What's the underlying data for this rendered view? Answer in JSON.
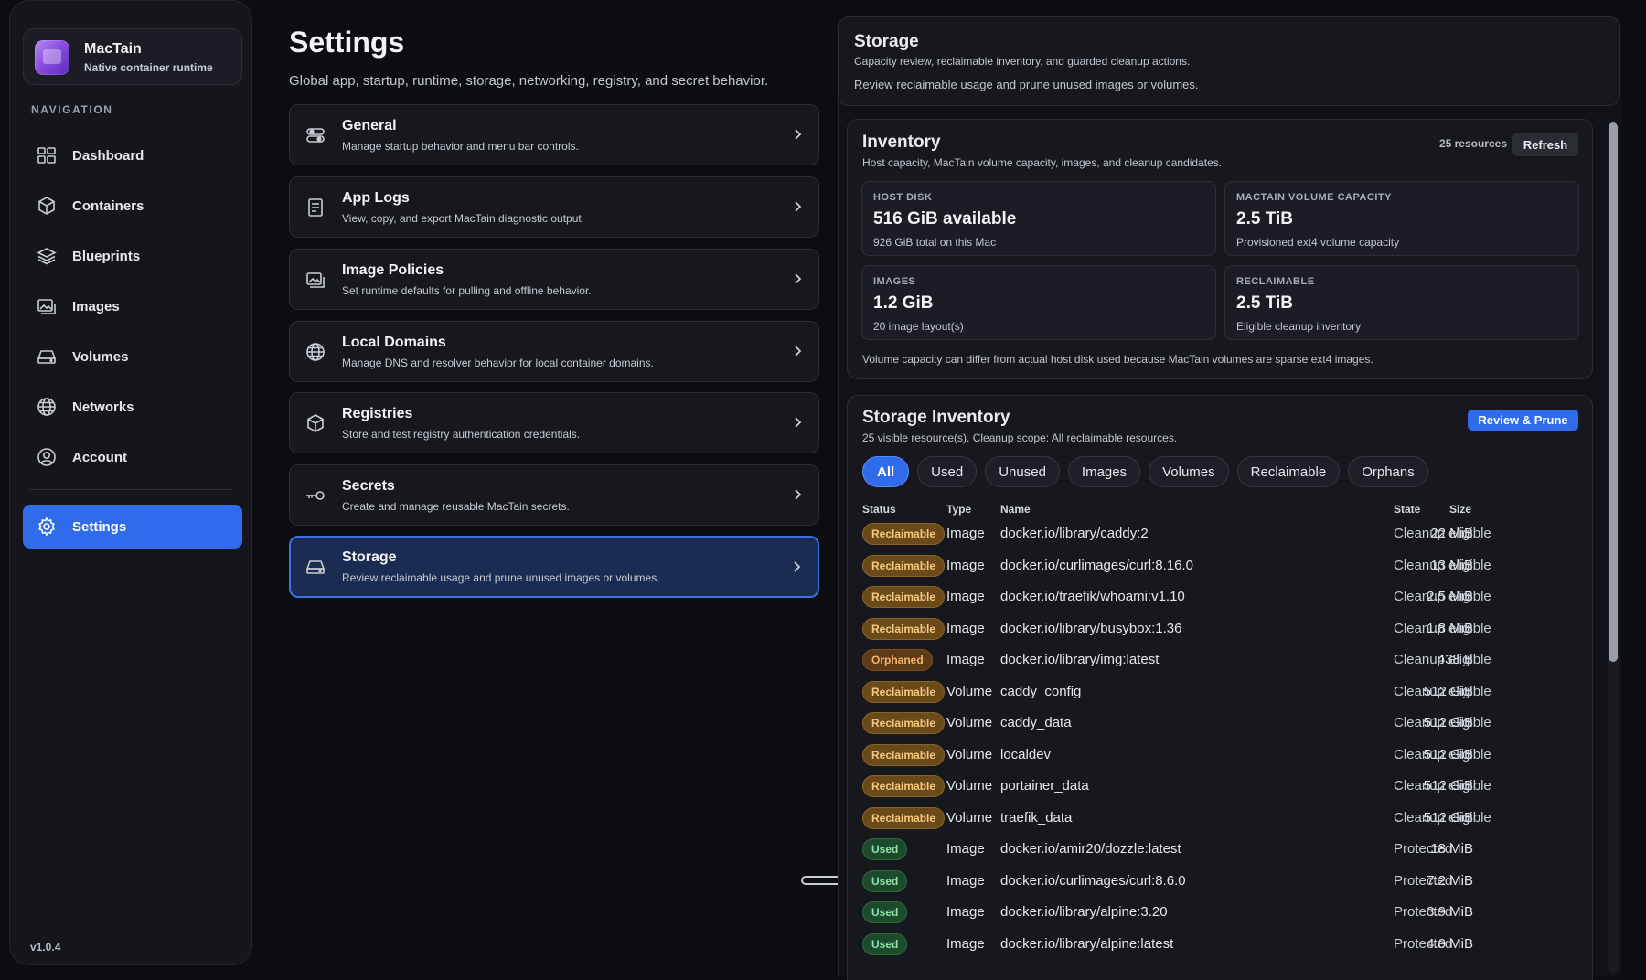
{
  "app": {
    "name": "MacTain",
    "subtitle": "Native container runtime",
    "version": "v1.0.4"
  },
  "sidebar": {
    "heading": "NAVIGATION",
    "items": [
      {
        "label": "Dashboard",
        "icon": "dashboard-icon"
      },
      {
        "label": "Containers",
        "icon": "containers-icon"
      },
      {
        "label": "Blueprints",
        "icon": "blueprints-icon"
      },
      {
        "label": "Images",
        "icon": "images-icon"
      },
      {
        "label": "Volumes",
        "icon": "volumes-icon"
      },
      {
        "label": "Networks",
        "icon": "networks-icon"
      },
      {
        "label": "Account",
        "icon": "account-icon"
      },
      {
        "label": "Settings",
        "icon": "gear-icon",
        "active": true
      }
    ]
  },
  "settings": {
    "title": "Settings",
    "subtitle": "Global app, startup, runtime, storage, networking, registry, and secret behavior.",
    "cards": [
      {
        "title": "General",
        "desc": "Manage startup behavior and menu bar controls.",
        "icon": "toggles-icon"
      },
      {
        "title": "App Logs",
        "desc": "View, copy, and export MacTain diagnostic output.",
        "icon": "log-icon"
      },
      {
        "title": "Image Policies",
        "desc": "Set runtime defaults for pulling and offline behavior.",
        "icon": "image-policy-icon"
      },
      {
        "title": "Local Domains",
        "desc": "Manage DNS and resolver behavior for local container domains.",
        "icon": "globe-icon"
      },
      {
        "title": "Registries",
        "desc": "Store and test registry authentication credentials.",
        "icon": "box-icon"
      },
      {
        "title": "Secrets",
        "desc": "Create and manage reusable MacTain secrets.",
        "icon": "key-icon"
      },
      {
        "title": "Storage",
        "desc": "Review reclaimable usage and prune unused images or volumes.",
        "icon": "drive-icon",
        "active": true
      }
    ]
  },
  "storage": {
    "title": "Storage",
    "subtitle": "Capacity review, reclaimable inventory, and guarded cleanup actions.",
    "description": "Review reclaimable usage and prune unused images or volumes.",
    "inventory": {
      "title": "Inventory",
      "subtitle": "Host capacity, MacTain volume capacity, images, and cleanup candidates.",
      "resource_count": "25 resources",
      "refresh_label": "Refresh",
      "stats": [
        {
          "label": "HOST DISK",
          "value": "516 GiB available",
          "note": "926 GiB total on this Mac"
        },
        {
          "label": "MACTAIN VOLUME CAPACITY",
          "value": "2.5 TiB",
          "note": "Provisioned ext4 volume capacity"
        },
        {
          "label": "IMAGES",
          "value": "1.2 GiB",
          "note": "20 image layout(s)"
        },
        {
          "label": "RECLAIMABLE",
          "value": "2.5 TiB",
          "note": "Eligible cleanup inventory"
        }
      ],
      "note": "Volume capacity can differ from actual host disk used because MacTain volumes are sparse ext4 images."
    },
    "storage_inventory": {
      "title": "Storage Inventory",
      "subtitle": "25 visible resource(s). Cleanup scope: All reclaimable resources.",
      "prune_label": "Review & Prune",
      "filters": [
        "All",
        "Used",
        "Unused",
        "Images",
        "Volumes",
        "Reclaimable",
        "Orphans"
      ],
      "active_filter": "All",
      "columns": {
        "status": "Status",
        "type": "Type",
        "name": "Name",
        "size": "Size",
        "state": "State"
      },
      "rows": [
        {
          "status": "Reclaimable",
          "type": "Image",
          "name": "docker.io/library/caddy:2",
          "size": "22 MiB",
          "state": "Cleanup eligible"
        },
        {
          "status": "Reclaimable",
          "type": "Image",
          "name": "docker.io/curlimages/curl:8.16.0",
          "size": "13 MiB",
          "state": "Cleanup eligible"
        },
        {
          "status": "Reclaimable",
          "type": "Image",
          "name": "docker.io/traefik/whoami:v1.10",
          "size": "2.5 MiB",
          "state": "Cleanup eligible"
        },
        {
          "status": "Reclaimable",
          "type": "Image",
          "name": "docker.io/library/busybox:1.36",
          "size": "1.8 MiB",
          "state": "Cleanup eligible"
        },
        {
          "status": "Orphaned",
          "type": "Image",
          "name": "docker.io/library/img:latest",
          "size": "438 B",
          "state": "Cleanup eligible"
        },
        {
          "status": "Reclaimable",
          "type": "Volume",
          "name": "caddy_config",
          "size": "512 GiB",
          "state": "Cleanup eligible"
        },
        {
          "status": "Reclaimable",
          "type": "Volume",
          "name": "caddy_data",
          "size": "512 GiB",
          "state": "Cleanup eligible"
        },
        {
          "status": "Reclaimable",
          "type": "Volume",
          "name": "localdev",
          "size": "512 GiB",
          "state": "Cleanup eligible"
        },
        {
          "status": "Reclaimable",
          "type": "Volume",
          "name": "portainer_data",
          "size": "512 GiB",
          "state": "Cleanup eligible"
        },
        {
          "status": "Reclaimable",
          "type": "Volume",
          "name": "traefik_data",
          "size": "512 GiB",
          "state": "Cleanup eligible"
        },
        {
          "status": "Used",
          "type": "Image",
          "name": "docker.io/amir20/dozzle:latest",
          "size": "18 MiB",
          "state": "Protected"
        },
        {
          "status": "Used",
          "type": "Image",
          "name": "docker.io/curlimages/curl:8.6.0",
          "size": "7.2 MiB",
          "state": "Protected"
        },
        {
          "status": "Used",
          "type": "Image",
          "name": "docker.io/library/alpine:3.20",
          "size": "3.9 MiB",
          "state": "Protected"
        },
        {
          "status": "Used",
          "type": "Image",
          "name": "docker.io/library/alpine:latest",
          "size": "4.0 MiB",
          "state": "Protected"
        }
      ]
    }
  },
  "colors": {
    "accent": "#2f6bea",
    "reclaimable": "#f5c87e",
    "orphaned": "#f2b46e",
    "used": "#8fe0a6"
  }
}
